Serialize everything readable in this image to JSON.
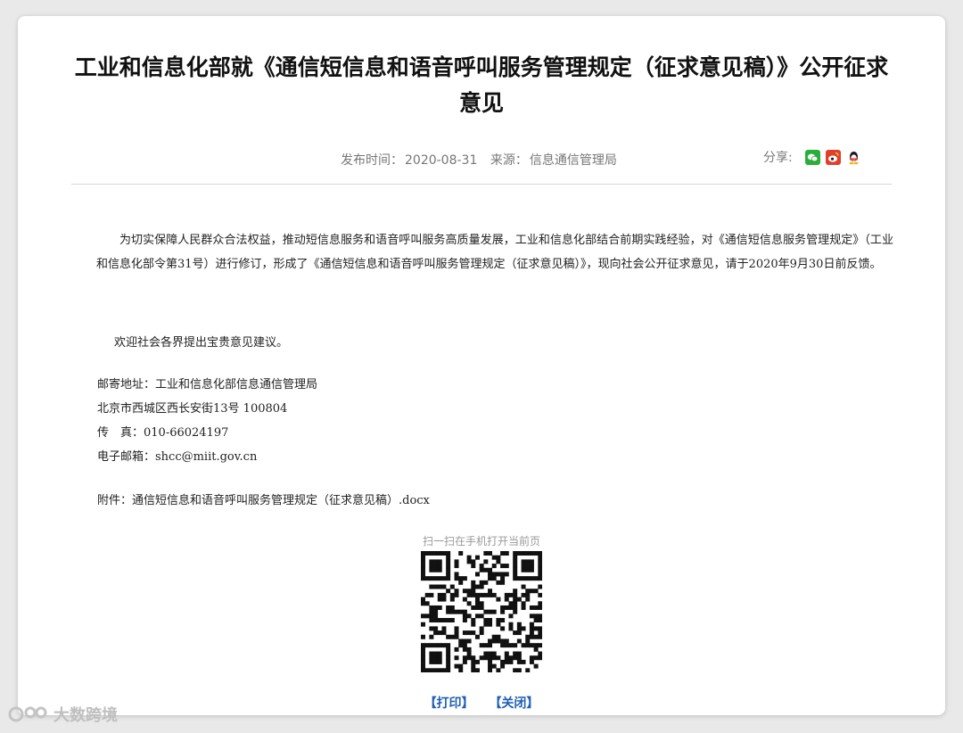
{
  "article": {
    "title": "工业和信息化部就《通信短信息和语音呼叫服务管理规定（征求意见稿）》公开征求意见",
    "publish_label": "发布时间：",
    "publish_date": "2020-08-31",
    "source_label": "来源：",
    "source": "信息通信管理局",
    "share_label": "分享:",
    "share_icons": [
      "wechat-icon",
      "weibo-icon",
      "qq-icon"
    ],
    "paragraph1": "为切实保障人民群众合法权益，推动短信息服务和语音呼叫服务高质量发展，工业和信息化部结合前期实践经验，对《通信短信息服务管理规定》（工业和信息化部令第31号）进行修订，形成了《通信短信息和语音呼叫服务管理规定（征求意见稿）》，现向社会公开征求意见，请于2020年9月30日前反馈。",
    "paragraph2": "欢迎社会各界提出宝贵意见建议。",
    "address_line1": "邮寄地址：工业和信息化部信息通信管理局",
    "address_line2": "北京市西城区西长安街13号 100804",
    "fax": "传　真：010-66024197",
    "email": "电子邮箱：shcc@miit.gov.cn",
    "attachment": "附件：通信短信息和语音呼叫服务管理规定（征求意见稿）.docx",
    "qr_label": "扫一扫在手机打开当前页",
    "print_link": "【打印】",
    "close_link": "【关闭】"
  },
  "watermark": "大数跨境",
  "colors": {
    "link": "#1f5fb4",
    "meta": "#777777",
    "background": "#e9e9e9"
  }
}
